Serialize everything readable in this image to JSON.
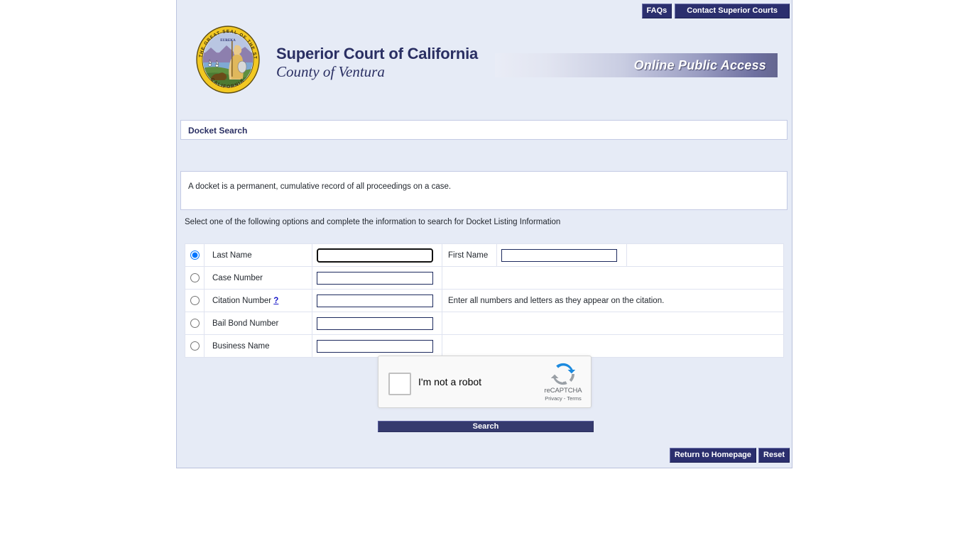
{
  "topnav": {
    "faqs_label": "FAQs",
    "contact_label": "Contact Superior Courts"
  },
  "masthead": {
    "seal_alt": "california-state-seal",
    "court_name": "Superior Court of California",
    "county_name": "County of Ventura",
    "banner_text": "Online Public Access"
  },
  "page": {
    "title": "Docket Search",
    "description": "A docket is a permanent, cumulative record of all proceedings on a case.",
    "instruction": "Select one of the following options and complete the information to search for Docket Listing Information"
  },
  "search_form": {
    "rows": [
      {
        "label": "Last Name",
        "selected": true,
        "value": "",
        "second_label": "First Name",
        "second_value": "",
        "note": "",
        "help": ""
      },
      {
        "label": "Case Number",
        "selected": false,
        "value": "",
        "second_label": "",
        "second_value": "",
        "note": "",
        "help": ""
      },
      {
        "label": "Citation Number",
        "selected": false,
        "value": "",
        "second_label": "",
        "second_value": "",
        "note": "Enter all numbers and letters as they appear on the citation.",
        "help": "?"
      },
      {
        "label": "Bail Bond Number",
        "selected": false,
        "value": "",
        "second_label": "",
        "second_value": "",
        "note": "",
        "help": ""
      },
      {
        "label": "Business Name",
        "selected": false,
        "value": "",
        "second_label": "",
        "second_value": "",
        "note": "",
        "help": ""
      }
    ]
  },
  "recaptcha": {
    "checkbox_label": "I'm not a robot",
    "brand": "reCAPTCHA",
    "links": "Privacy - Terms",
    "logo_icon": "recaptcha-icon"
  },
  "actions": {
    "search_label": "Search",
    "return_home_label": "Return to Homepage",
    "reset_label": "Reset"
  },
  "colors": {
    "navy": "#2b2f6e",
    "panel_border": "#c3cae4",
    "page_bg": "#e6ebf6",
    "link_blue": "#1515c8"
  }
}
